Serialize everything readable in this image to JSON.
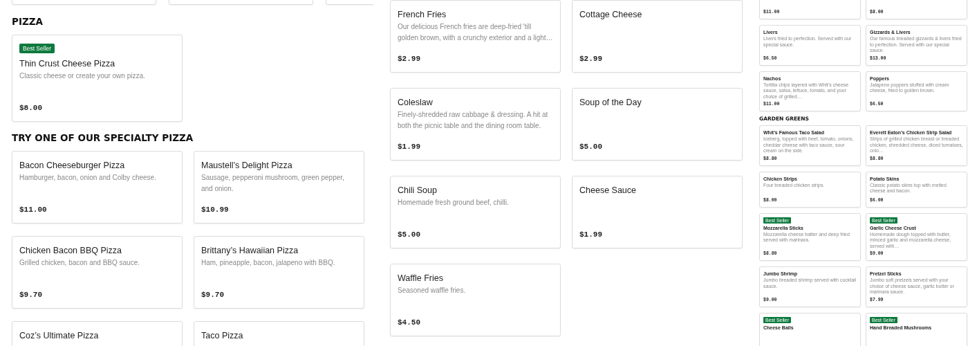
{
  "panels": [
    {
      "blocks": [
        {
          "kind": "cut_row"
        },
        {
          "kind": "heading",
          "text": "PIZZA"
        },
        {
          "kind": "grid",
          "cards": [
            {
              "title": "Thin Crust Cheese Pizza",
              "description": "Classic cheese or create your own pizza.",
              "price": "$8.00",
              "best_seller": true,
              "badge": "Best Seller"
            }
          ]
        },
        {
          "kind": "heading",
          "text": "TRY ONE OF OUR SPECIALTY PIZZA"
        },
        {
          "kind": "grid",
          "cards": [
            {
              "title": "Bacon Cheeseburger Pizza",
              "description": "Hamburger, bacon, onion and Colby cheese.",
              "price": "$11.00",
              "best_seller": false
            },
            {
              "title": "Maustell’s Delight Pizza",
              "description": "Sausage, pepperoni mushroom, green pepper, and onion.",
              "price": "$10.99",
              "best_seller": false
            },
            {
              "title": "Chicken Bacon BBQ Pizza",
              "description": "Grilled chicken, bacon and BBQ sauce.",
              "price": "$9.70",
              "best_seller": false
            },
            {
              "title": "Brittany’s Hawaiian Pizza",
              "description": "Ham, pineapple, bacon, jalapeno with BBQ.",
              "price": "$9.70",
              "best_seller": false
            },
            {
              "title": "Coz’s Ultimate Pizza",
              "best_seller": false
            },
            {
              "title": "Taco Pizza",
              "best_seller": false
            }
          ]
        }
      ]
    },
    {
      "blocks": [
        {
          "kind": "grid",
          "cards": [
            {
              "title": "French Fries",
              "description": "Our delicious French fries are deep-fried 'till golden brown, with a crunchy exterior and a light…",
              "price": "$2.99",
              "best_seller": false
            },
            {
              "title": "Cottage Cheese",
              "price": "$2.99",
              "best_seller": false
            },
            {
              "title": "Coleslaw",
              "description": "Finely-shredded raw cabbage & dressing. A hit at both the picnic table and the dining room table.",
              "price": "$1.99",
              "best_seller": false
            },
            {
              "title": "Soup of the Day",
              "price": "$5.00",
              "best_seller": false
            },
            {
              "title": "Chili Soup",
              "description": "Homemade fresh ground beef, chilli.",
              "price": "$5.00",
              "best_seller": false
            },
            {
              "title": "Cheese Sauce",
              "price": "$1.99",
              "best_seller": false
            },
            {
              "title": "Waffle Fries",
              "description": "Seasoned waffle fries.",
              "price": "$4.50",
              "best_seller": false
            }
          ]
        }
      ]
    },
    {
      "blocks": [
        {
          "kind": "grid",
          "cards": [
            {
              "price": "$11.00"
            },
            {
              "price": "$8.00"
            },
            {
              "title": "Livers",
              "description": "Livers fried to perfection. Served with our special sauce.",
              "price": "$6.50",
              "best_seller": false
            },
            {
              "title": "Gizzards & Livers",
              "description": "Our famous breaded gizzards & livers fried to perfection. Served with our special sauce.",
              "price": "$13.00",
              "best_seller": false
            },
            {
              "title": "Nachos",
              "description": "Tortilla chips layered with Whit’s cheese sauce, salsa, lettuce, tomato, and your choice of grilled…",
              "price": "$11.00",
              "best_seller": false
            },
            {
              "title": "Poppers",
              "description": "Jalapeno poppers stuffed with cream cheese, fried to golden brown.",
              "price": "$6.50",
              "best_seller": false
            }
          ]
        },
        {
          "kind": "heading",
          "text": "GARDEN GREENS"
        },
        {
          "kind": "grid",
          "cards": [
            {
              "title": "Whit’s Famous Taco Salad",
              "description": "Iceberg, topped with beef, tomato, onions, cheddar cheese with taco sauce, sour cream on the side.",
              "price": "$8.80",
              "best_seller": false
            },
            {
              "title": "Everett Eaton’s Chicken Strip Salad",
              "description": "Strips of grilled chicken breast or breaded chicken, shredded cheese, diced tomatoes, onio…",
              "price": "$8.80",
              "best_seller": false
            },
            {
              "title": "Chicken Strips",
              "description": "Four breaded chicken strips.",
              "price": "$8.00",
              "best_seller": false
            },
            {
              "title": "Potato Skins",
              "description": "Classic potato skins top with melted cheese and bacon.",
              "price": "$6.00",
              "best_seller": false
            },
            {
              "title": "Mozzarella Sticks",
              "description": "Mozzarella cheese batter and deep fried served with marinara.",
              "price": "$8.80",
              "best_seller": true,
              "badge": "Best Seller"
            },
            {
              "title": "Garlic Cheese Crust",
              "description": "Homemade dough topped with butter, minced garlic and mozzarella cheese, served with…",
              "price": "$9.00",
              "best_seller": true,
              "badge": "Best Seller"
            },
            {
              "title": "Jumbo Shrimp",
              "description": "Jumbo breaded shrimp served with cocktail sauce.",
              "price": "$9.00",
              "best_seller": false
            },
            {
              "title": "Pretzel Sticks",
              "description": "Jumbo soft pretzels served with your choice of cheese sauce, garlic butter or marinara sauce.",
              "price": "$7.99",
              "best_seller": false
            },
            {
              "title": "Cheese Balls",
              "best_seller": true,
              "badge": "Best Seller"
            },
            {
              "title": "Hand Breaded Mushrooms",
              "best_seller": true,
              "badge": "Best Seller"
            }
          ]
        }
      ]
    }
  ]
}
